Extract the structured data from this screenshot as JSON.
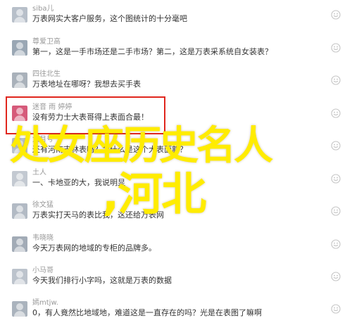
{
  "comments": [
    {
      "name": "siba儿",
      "text": "万表网实大客户服务，这个图统计的十分毫吧",
      "avatar_color": "#b7bfc9"
    },
    {
      "name": "尊爱卫高",
      "text": "第一，这是一手市场还是二手市场？第二，这是万表采系统自女装表？",
      "avatar_color": "#9aa7b4"
    },
    {
      "name": "四往北生",
      "text": "万表地址在哪呀？我想去买手表",
      "avatar_color": "#a9b1ba"
    },
    {
      "name": "迷音 雨 婷婷",
      "text": "没有劳力士大表哥得上表面合最！",
      "avatar_color": "#d65a7a"
    },
    {
      "name": "犬月号",
      "text": "还有河南吉林表吗？为什么是这个大表面新？",
      "avatar_color": "#b9c2cc"
    },
    {
      "name": "土人",
      "text": "一、卡地亚的大，我说明显",
      "avatar_color": "#c3c9d1"
    },
    {
      "name": "徐文猛",
      "text": "万表实打天马的表比我，这还给万表网",
      "avatar_color": "#b2bac4"
    },
    {
      "name": "韦晓晓",
      "text": "今天万表网的地域的专柜的品牌多。",
      "avatar_color": "#a2abb6"
    },
    {
      "name": "小马哥",
      "text": "今天我们排行小字吗，这就是万表的数据",
      "avatar_color": "#bcc3cc"
    },
    {
      "name": "嫣mtjw.",
      "text": "0，有人竟然比地域地，难道这是一直存在的吗？光是在表图了嘛啊",
      "avatar_color": "#aab3bd"
    }
  ],
  "overlay": {
    "line1": "处女座历史名人",
    "line2": ",河北",
    "color": "#ffec00"
  },
  "highlight_color": "#e0261d",
  "icon": "emoji-smile-icon"
}
